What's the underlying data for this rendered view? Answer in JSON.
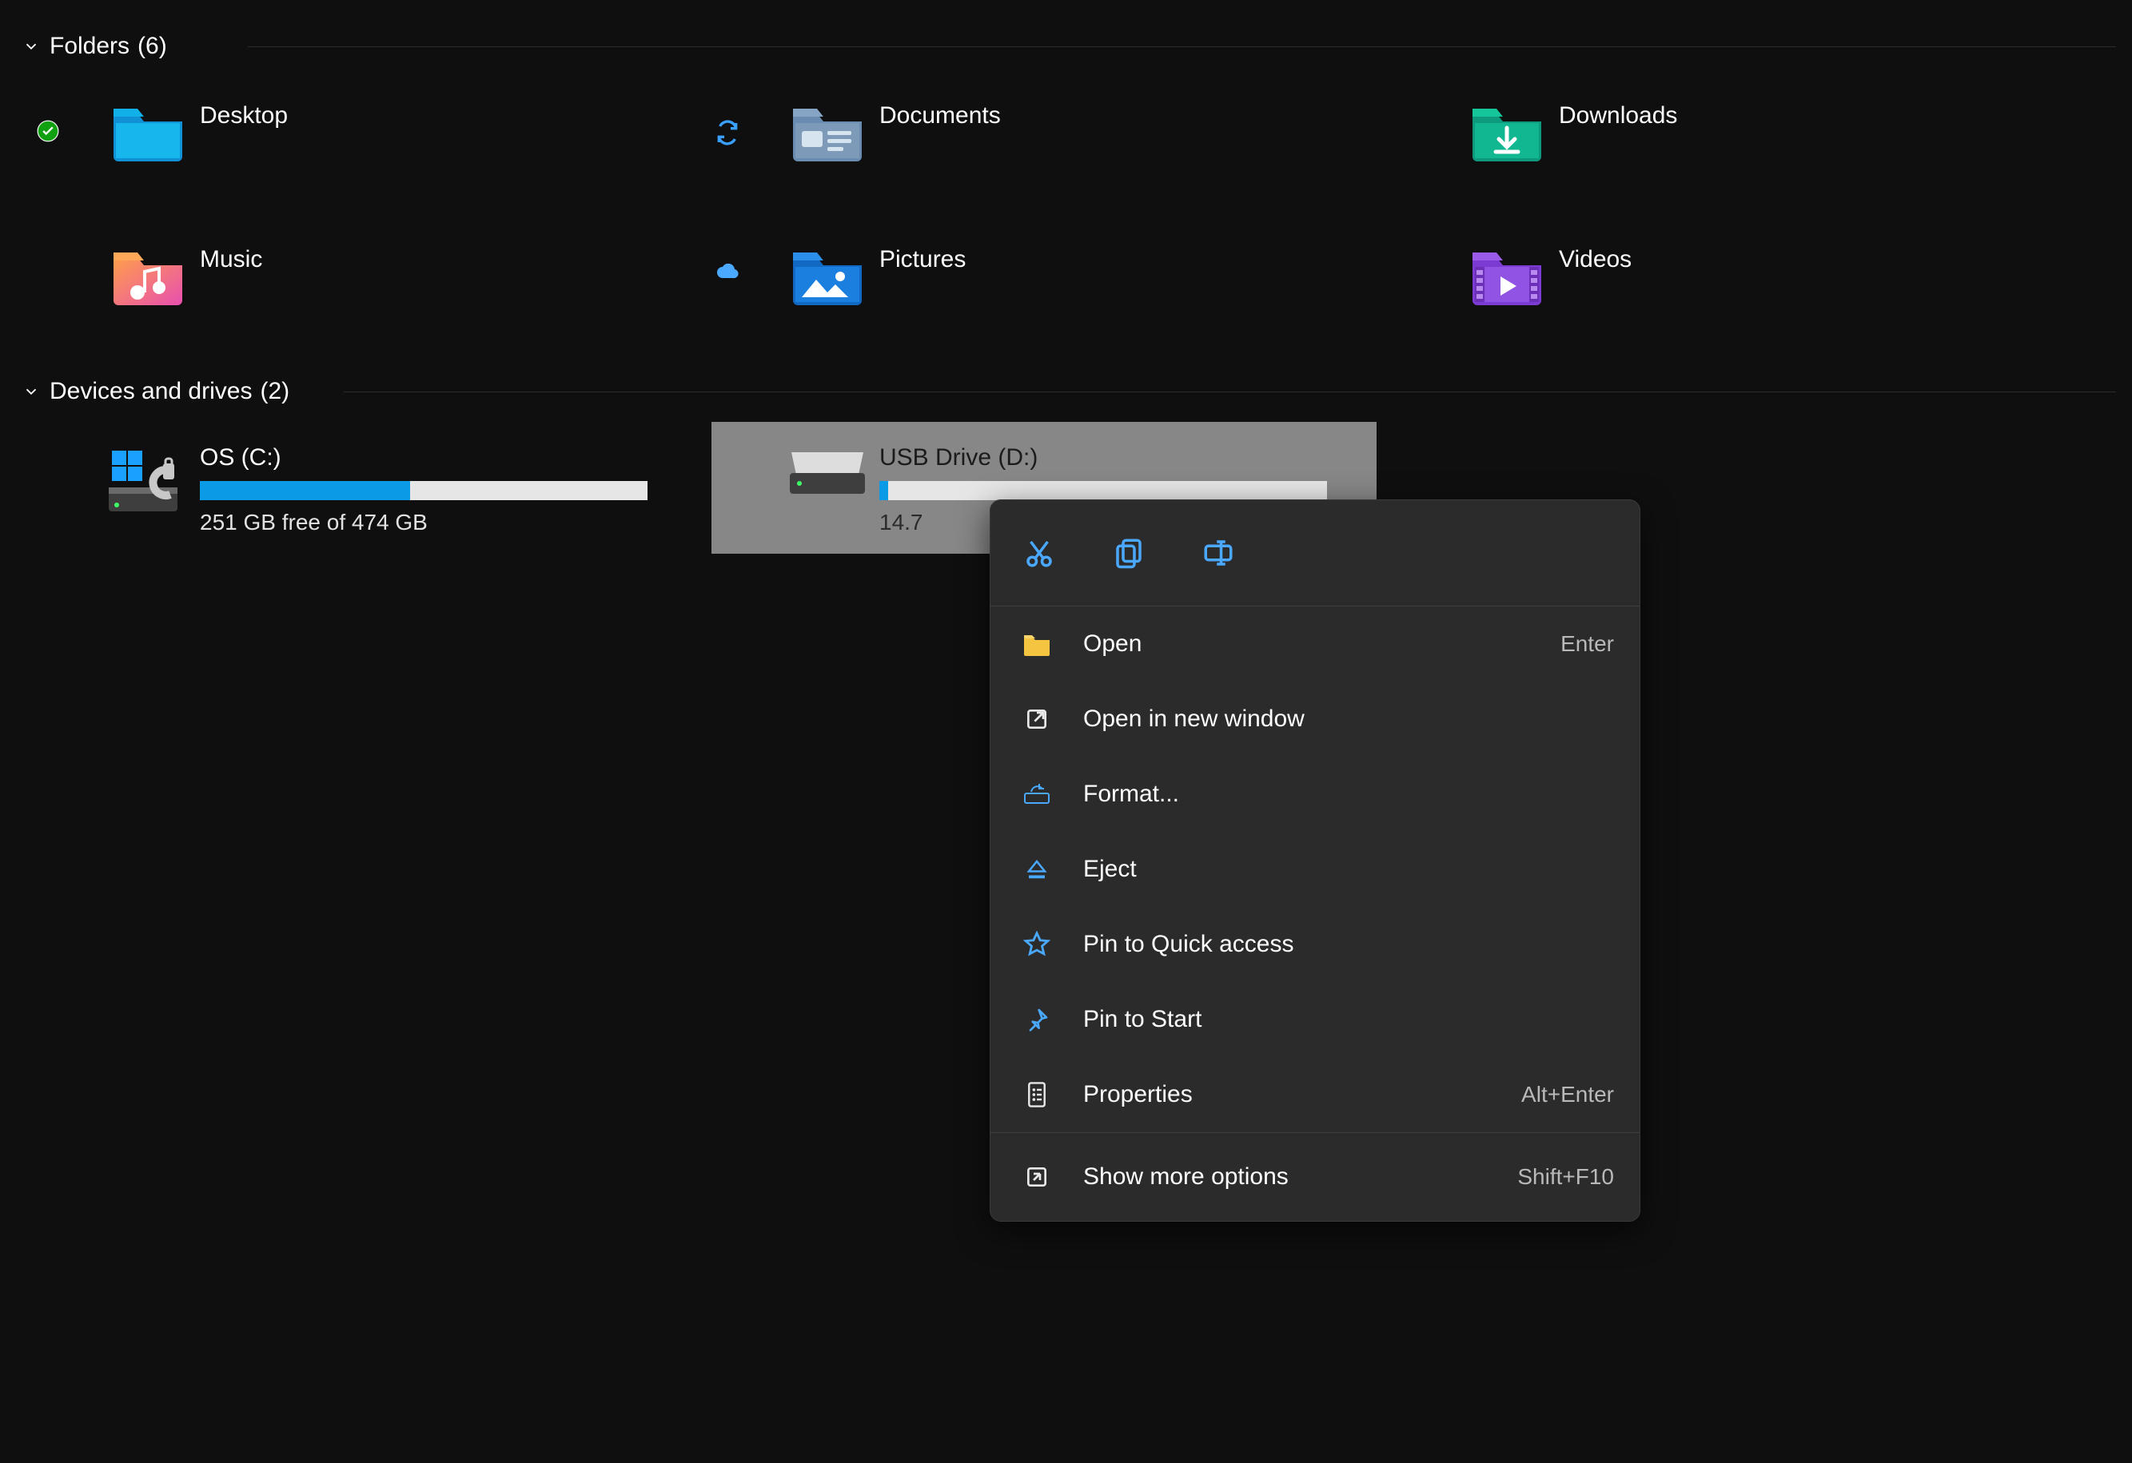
{
  "groups": {
    "folders": {
      "label": "Folders",
      "count": "(6)"
    },
    "drives": {
      "label": "Devices and drives",
      "count": "(2)"
    }
  },
  "folders": [
    {
      "label": "Desktop",
      "status": "check",
      "icon": "desktop"
    },
    {
      "label": "Documents",
      "status": "sync",
      "icon": "documents"
    },
    {
      "label": "Downloads",
      "status": "",
      "icon": "downloads"
    },
    {
      "label": "Music",
      "status": "",
      "icon": "music"
    },
    {
      "label": "Pictures",
      "status": "cloud",
      "icon": "pictures"
    },
    {
      "label": "Videos",
      "status": "",
      "icon": "videos"
    }
  ],
  "drives": [
    {
      "label": "OS (C:)",
      "sub": "251 GB free of 474 GB",
      "fill_percent": 47,
      "selected": false,
      "icon": "os"
    },
    {
      "label": "USB Drive (D:)",
      "sub": "14.7",
      "fill_percent": 2,
      "selected": true,
      "icon": "usb"
    }
  ],
  "ctx": {
    "top_icons": [
      "cut",
      "copy",
      "rename"
    ],
    "items": [
      {
        "icon": "folder-open",
        "label": "Open",
        "short": "Enter"
      },
      {
        "icon": "open-new",
        "label": "Open in new window",
        "short": ""
      },
      {
        "icon": "format",
        "label": "Format...",
        "short": ""
      },
      {
        "icon": "eject",
        "label": "Eject",
        "short": ""
      },
      {
        "icon": "star",
        "label": "Pin to Quick access",
        "short": ""
      },
      {
        "icon": "pin",
        "label": "Pin to Start",
        "short": ""
      },
      {
        "icon": "properties",
        "label": "Properties",
        "short": "Alt+Enter"
      }
    ],
    "more": {
      "icon": "more",
      "label": "Show more options",
      "short": "Shift+F10"
    }
  }
}
